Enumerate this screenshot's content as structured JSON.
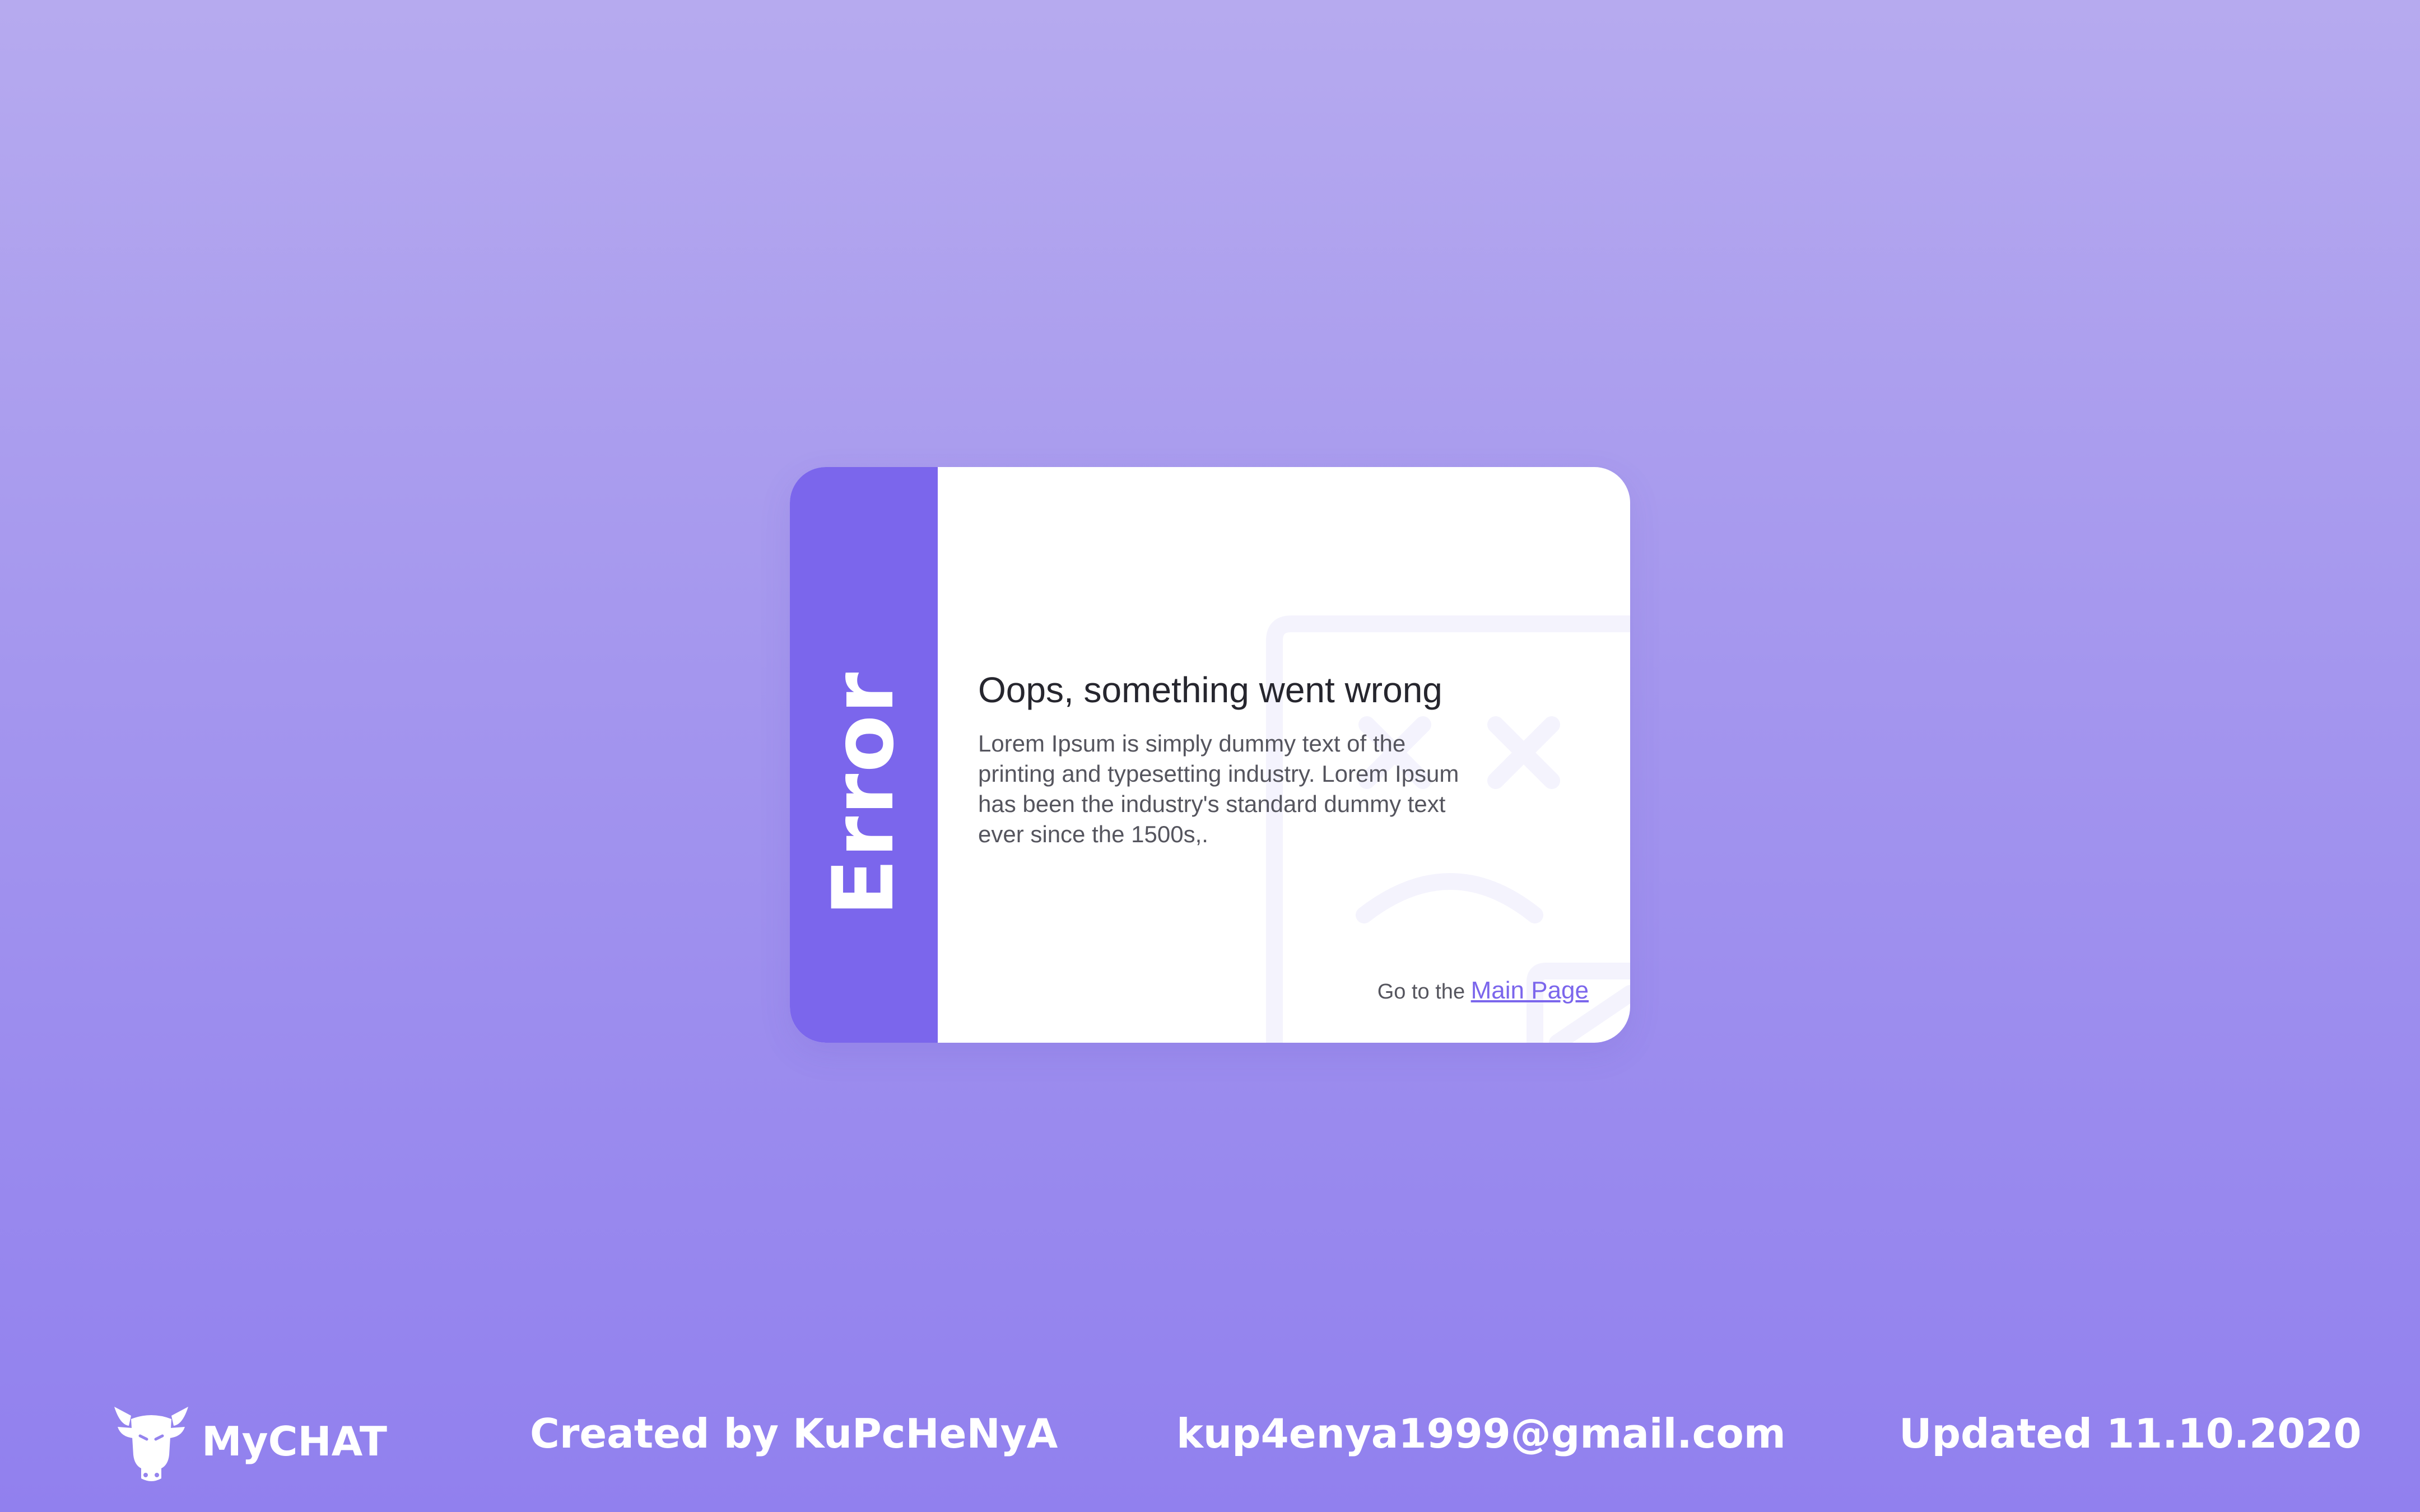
{
  "colors": {
    "accent": "#7b66ec",
    "background_top": "#b6aaef",
    "background_bottom": "#9180ee",
    "card": "#ffffff",
    "text_dark": "#26262e",
    "text_muted": "#55555e"
  },
  "card": {
    "side_label": "Error",
    "title": "Oops, something went wrong",
    "description": "Lorem Ipsum is simply dummy text of the printing and typesetting industry. Lorem Ipsum has been the industry's standard dummy text ever since the 1500s,.",
    "footer_prefix": "Go to the",
    "footer_link": "Main Page",
    "illustration_icon": "sad-face-document-icon"
  },
  "footer": {
    "brand_icon": "cow-head-icon",
    "brand_name": "MyCHAT",
    "created_by": "Created by KuPcHeNyA",
    "email": "kup4enya1999@gmail.com",
    "updated": "Updated 11.10.2020"
  }
}
